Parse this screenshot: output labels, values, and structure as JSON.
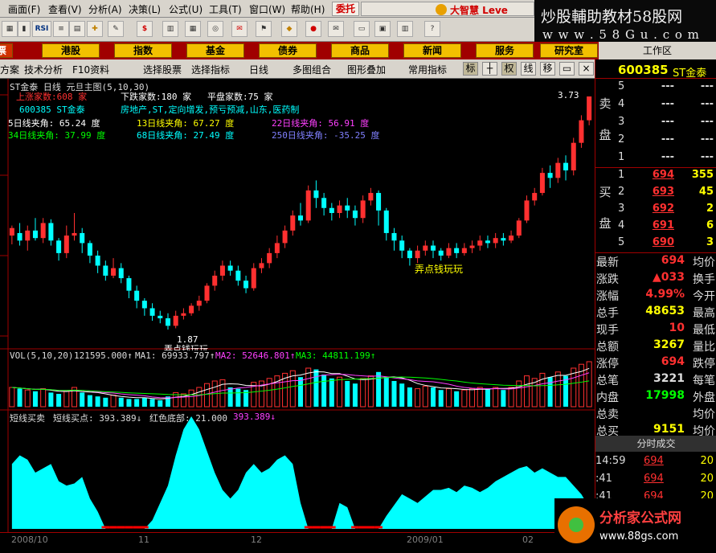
{
  "menu": [
    "画面(F)",
    "查看(V)",
    "分析(A)",
    "决策(L)",
    "公式(U)",
    "工具(T)",
    "窗口(W)",
    "帮助(H)"
  ],
  "order_button": "委托",
  "brand_text": "大智慧 Leve",
  "banner": {
    "line1": "炒股輔助教材58股网",
    "line2": "w w w . 5 8 G u . c o m"
  },
  "toolbar_icons": [
    "RSI-icon"
  ],
  "toolbar_rsi": "RSI",
  "nav": {
    "first": "票",
    "items": [
      "港股",
      "指数",
      "基金",
      "债券",
      "商品",
      "新闻",
      "服务",
      "研究室"
    ]
  },
  "workzone": "工作区",
  "tabs": [
    "方案",
    "技术分析",
    "F10资料",
    "选择股票",
    "选择指标",
    "日线",
    "多图组合",
    "图形叠加",
    "常用指标"
  ],
  "toggles": [
    "标",
    "",
    "权",
    "线",
    "移"
  ],
  "stock": {
    "code": "600385",
    "name": "ST金泰"
  },
  "main_panel": {
    "title": "ST金泰 日线 元旦主图(5,10,30)",
    "up_count": "上涨家数:608 家",
    "down_count": "下跌家数:180 家",
    "flat_count": "平盘家数:75 家",
    "stock_line": "600385 ST金泰",
    "concepts": "房地产,ST,定向增发,预亏预减,山东,医药制",
    "angles": [
      {
        "label": "5日线夹角: 65.24 度",
        "color": "#ffffff"
      },
      {
        "label": "13日线夹角: 67.27 度",
        "color": "#ffff00"
      },
      {
        "label": "22日线夹角: 56.91 度",
        "color": "#ff40ff"
      },
      {
        "label": "34日线夹角: 37.99 度",
        "color": "#00ff00"
      },
      {
        "label": "68日线夹角: 27.49 度",
        "color": "#00ffff"
      },
      {
        "label": "250日线夹角: -35.25 度",
        "color": "#8080ff"
      }
    ],
    "annot_mid": "弄点钱玩玩",
    "annot_low": "弄点钱玩玩",
    "low_label": "1.87",
    "high_label": "3.73"
  },
  "vol_panel": {
    "title": "VOL(5,10,20)",
    "vol": "121595.000↑",
    "ma1": "MA1: 69933.797↑",
    "ma2": "MA2: 52646.801↑",
    "ma3": "MA3: 44811.199↑"
  },
  "ind_panel": {
    "title": "短线买卖",
    "buy": "短线买点: 393.389↓",
    "red": "红色底部: 21.000",
    "val": "393.389↓"
  },
  "time_axis": [
    "2008/10",
    "11",
    "12",
    "2009/01",
    "02"
  ],
  "colors": {
    "up": "#ff3030",
    "down": "#00ffff",
    "accent": "#a00000",
    "highlight": "#ffff00"
  },
  "orderbook": {
    "sell_label": [
      "卖",
      "盘"
    ],
    "buy_label": [
      "买",
      "盘"
    ],
    "sell": [
      {
        "n": "5",
        "p": "---",
        "v": "---"
      },
      {
        "n": "4",
        "p": "---",
        "v": "---"
      },
      {
        "n": "3",
        "p": "---",
        "v": "---"
      },
      {
        "n": "2",
        "p": "---",
        "v": "---"
      },
      {
        "n": "1",
        "p": "---",
        "v": "---"
      }
    ],
    "buy": [
      {
        "n": "1",
        "p": "694",
        "v": "355"
      },
      {
        "n": "2",
        "p": "693",
        "v": "45"
      },
      {
        "n": "3",
        "p": "692",
        "v": "2"
      },
      {
        "n": "4",
        "p": "691",
        "v": "6"
      },
      {
        "n": "5",
        "p": "690",
        "v": "3"
      }
    ]
  },
  "quote_rows": [
    {
      "a": "最新",
      "b": "694",
      "bc": "#ff3030",
      "c": "均价"
    },
    {
      "a": "涨跌",
      "b": "▲033",
      "bc": "#ff3030",
      "c": "换手"
    },
    {
      "a": "涨幅",
      "b": "4.99%",
      "bc": "#ff3030",
      "c": "今开"
    },
    {
      "a": "总手",
      "b": "48653",
      "bc": "#ffff00",
      "c": "最高"
    },
    {
      "a": "现手",
      "b": "10",
      "bc": "#ff3030",
      "c": "最低"
    },
    {
      "a": "总额",
      "b": "3267",
      "bc": "#ffff00",
      "c": "量比"
    },
    {
      "a": "涨停",
      "b": "694",
      "bc": "#ff3030",
      "c": "跌停"
    },
    {
      "a": "总笔",
      "b": "3221",
      "bc": "#dcdcdc",
      "c": "每笔"
    },
    {
      "a": "内盘",
      "b": "17998",
      "bc": "#00ff00",
      "c": "外盘"
    },
    {
      "a": "总卖",
      "b": "",
      "bc": "#dcdcdc",
      "c": "均价"
    },
    {
      "a": "总买",
      "b": "9151",
      "bc": "#ffff00",
      "c": "均价"
    }
  ],
  "ticks_header": "分时成交",
  "ticks": [
    {
      "t": "14:59",
      "p": "694",
      "v": "20"
    },
    {
      "t": ":41",
      "p": "694",
      "v": "20"
    },
    {
      "t": ":41",
      "p": "694",
      "v": "20"
    }
  ],
  "logo": {
    "line1": "分析家公式网",
    "line2": "www.88gs.com"
  },
  "chart_data": {
    "type": "candlestick",
    "price_range": [
      1.87,
      3.73
    ],
    "candles": [
      [
        2.62,
        2.68,
        2.55,
        2.7
      ],
      [
        2.64,
        2.58,
        2.54,
        2.72
      ],
      [
        2.58,
        2.66,
        2.5,
        2.7
      ],
      [
        2.66,
        2.6,
        2.58,
        2.76
      ],
      [
        2.6,
        2.72,
        2.56,
        2.76
      ],
      [
        2.72,
        2.58,
        2.54,
        2.75
      ],
      [
        2.58,
        2.48,
        2.42,
        2.6
      ],
      [
        2.48,
        2.62,
        2.44,
        2.7
      ],
      [
        2.62,
        2.64,
        2.58,
        2.8
      ],
      [
        2.64,
        2.56,
        2.48,
        2.68
      ],
      [
        2.56,
        2.46,
        2.4,
        2.58
      ],
      [
        2.46,
        2.38,
        2.32,
        2.5
      ],
      [
        2.38,
        2.3,
        2.26,
        2.42
      ],
      [
        2.3,
        2.36,
        2.28,
        2.44
      ],
      [
        2.36,
        2.28,
        2.24,
        2.4
      ],
      [
        2.28,
        2.18,
        2.12,
        2.3
      ],
      [
        2.18,
        2.1,
        2.04,
        2.22
      ],
      [
        2.1,
        2.04,
        1.98,
        2.12
      ],
      [
        2.04,
        1.98,
        1.94,
        2.08
      ],
      [
        1.98,
        1.96,
        1.92,
        2.02
      ],
      [
        1.96,
        1.9,
        1.87,
        2.0
      ],
      [
        1.9,
        1.98,
        1.88,
        2.02
      ],
      [
        1.98,
        2.0,
        1.95,
        2.04
      ],
      [
        2.0,
        2.06,
        1.98,
        2.08
      ],
      [
        2.06,
        2.1,
        2.02,
        2.14
      ],
      [
        2.1,
        2.22,
        2.08,
        2.24
      ],
      [
        2.22,
        2.3,
        2.18,
        2.34
      ],
      [
        2.3,
        2.38,
        2.26,
        2.42
      ],
      [
        2.38,
        2.34,
        2.3,
        2.42
      ],
      [
        2.34,
        2.26,
        2.22,
        2.38
      ],
      [
        2.26,
        2.2,
        2.16,
        2.3
      ],
      [
        2.2,
        2.36,
        2.18,
        2.4
      ],
      [
        2.36,
        2.4,
        2.32,
        2.44
      ],
      [
        2.4,
        2.48,
        2.36,
        2.52
      ],
      [
        2.48,
        2.56,
        2.44,
        2.62
      ],
      [
        2.56,
        2.66,
        2.52,
        2.7
      ],
      [
        2.66,
        2.78,
        2.62,
        2.82
      ],
      [
        2.78,
        2.74,
        2.7,
        2.88
      ],
      [
        2.74,
        2.98,
        2.72,
        3.02
      ],
      [
        2.98,
        2.92,
        2.84,
        3.06
      ],
      [
        2.92,
        2.84,
        2.78,
        2.96
      ],
      [
        2.84,
        2.8,
        2.74,
        2.88
      ],
      [
        2.8,
        2.86,
        2.76,
        2.9
      ],
      [
        2.86,
        2.82,
        2.76,
        2.92
      ],
      [
        2.82,
        2.76,
        2.7,
        2.86
      ],
      [
        2.76,
        2.9,
        2.72,
        2.94
      ],
      [
        2.9,
        2.96,
        2.86,
        3.0
      ],
      [
        2.96,
        2.82,
        2.7,
        2.98
      ],
      [
        2.82,
        2.64,
        2.58,
        2.84
      ],
      [
        2.64,
        2.58,
        2.5,
        2.68
      ],
      [
        2.58,
        2.5,
        2.44,
        2.62
      ],
      [
        2.5,
        2.44,
        2.38,
        2.52
      ],
      [
        2.44,
        2.5,
        2.4,
        2.54
      ],
      [
        2.5,
        2.54,
        2.46,
        2.58
      ],
      [
        2.54,
        2.5,
        2.44,
        2.58
      ],
      [
        2.5,
        2.46,
        2.42,
        2.52
      ],
      [
        2.46,
        2.52,
        2.44,
        2.56
      ],
      [
        2.52,
        2.48,
        2.44,
        2.56
      ],
      [
        2.48,
        2.52,
        2.46,
        2.56
      ],
      [
        2.52,
        2.54,
        2.48,
        2.58
      ],
      [
        2.54,
        2.58,
        2.5,
        2.62
      ],
      [
        2.58,
        2.56,
        2.52,
        2.62
      ],
      [
        2.56,
        2.6,
        2.52,
        2.64
      ],
      [
        2.6,
        2.58,
        2.54,
        2.64
      ],
      [
        2.58,
        2.62,
        2.56,
        2.66
      ],
      [
        2.62,
        2.74,
        2.6,
        2.76
      ],
      [
        2.74,
        2.9,
        2.72,
        2.94
      ],
      [
        2.9,
        2.96,
        2.86,
        3.0
      ],
      [
        2.96,
        3.12,
        2.94,
        3.16
      ],
      [
        3.12,
        3.08,
        3.0,
        3.18
      ],
      [
        3.08,
        3.2,
        3.04,
        3.24
      ],
      [
        3.2,
        3.14,
        3.06,
        3.26
      ],
      [
        3.14,
        3.36,
        3.1,
        3.4
      ],
      [
        3.36,
        3.54,
        3.32,
        3.58
      ],
      [
        3.54,
        3.73,
        3.5,
        3.73
      ]
    ],
    "volume": [
      30,
      28,
      26,
      24,
      28,
      22,
      20,
      24,
      30,
      22,
      18,
      16,
      14,
      18,
      14,
      12,
      12,
      14,
      12,
      10,
      16,
      22,
      20,
      26,
      30,
      36,
      40,
      42,
      30,
      28,
      26,
      38,
      40,
      44,
      48,
      52,
      56,
      46,
      60,
      58,
      50,
      44,
      46,
      40,
      36,
      44,
      48,
      54,
      46,
      40,
      36,
      30,
      28,
      32,
      30,
      26,
      28,
      24,
      26,
      28,
      30,
      28,
      30,
      26,
      30,
      40,
      48,
      44,
      52,
      46,
      54,
      48,
      60,
      66,
      70
    ],
    "ma_lines": [
      "MA1",
      "MA2",
      "MA3"
    ],
    "indicator": [
      150,
      170,
      160,
      130,
      140,
      150,
      110,
      100,
      105,
      120,
      70,
      40,
      0,
      0,
      0,
      0,
      0,
      0,
      20,
      60,
      100,
      170,
      230,
      260,
      230,
      180,
      130,
      90,
      70,
      90,
      130,
      150,
      130,
      140,
      160,
      170,
      150,
      60,
      0,
      0,
      0,
      0,
      60,
      50,
      0,
      0,
      0,
      0,
      30,
      55,
      80,
      70,
      60,
      75,
      90,
      90,
      95,
      85,
      100,
      95,
      85,
      95,
      110,
      120,
      130,
      140,
      145,
      130,
      140,
      130,
      120,
      120,
      100,
      80,
      50
    ],
    "indicator_range": [
      0,
      393.389
    ]
  }
}
